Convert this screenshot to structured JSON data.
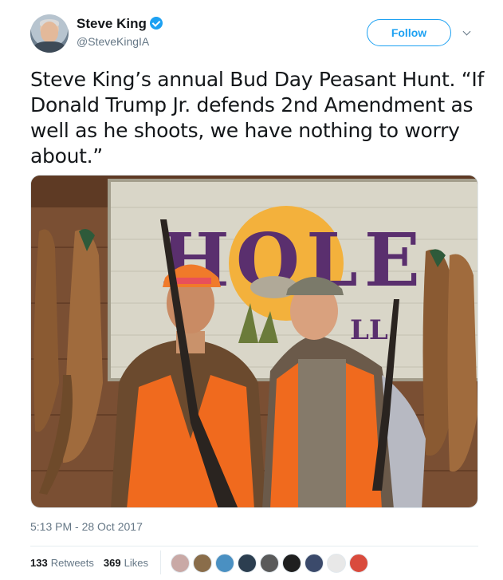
{
  "author": {
    "name": "Steve King",
    "handle": "@SteveKingIA",
    "verified": true
  },
  "actions": {
    "follow_label": "Follow"
  },
  "tweet": {
    "text": "Steve King’s annual Bud Day Peasant Hunt. “If Donald Trump Jr. defends 2nd Amendment as well as he shoots, we have nothing to worry about.”",
    "timestamp": "5:13 PM - 28 Oct 2017"
  },
  "photo": {
    "sign_text": "HOLE",
    "sign_text_2": "LL"
  },
  "stats": {
    "retweets_count": "133",
    "retweets_label": "Retweets",
    "likes_count": "369",
    "likes_label": "Likes"
  },
  "likers": [
    {
      "color": "#c9a9a6"
    },
    {
      "color": "#8a6d4a"
    },
    {
      "color": "#4a90c2"
    },
    {
      "color": "#2c3e50"
    },
    {
      "color": "#5a5a5a"
    },
    {
      "color": "#1f1f1f"
    },
    {
      "color": "#3b4a6b"
    },
    {
      "color": "#e8e8e8"
    },
    {
      "color": "#d94b3d"
    }
  ],
  "colors": {
    "accent": "#1da1f2",
    "text_primary": "#14171a",
    "text_secondary": "#657786"
  }
}
